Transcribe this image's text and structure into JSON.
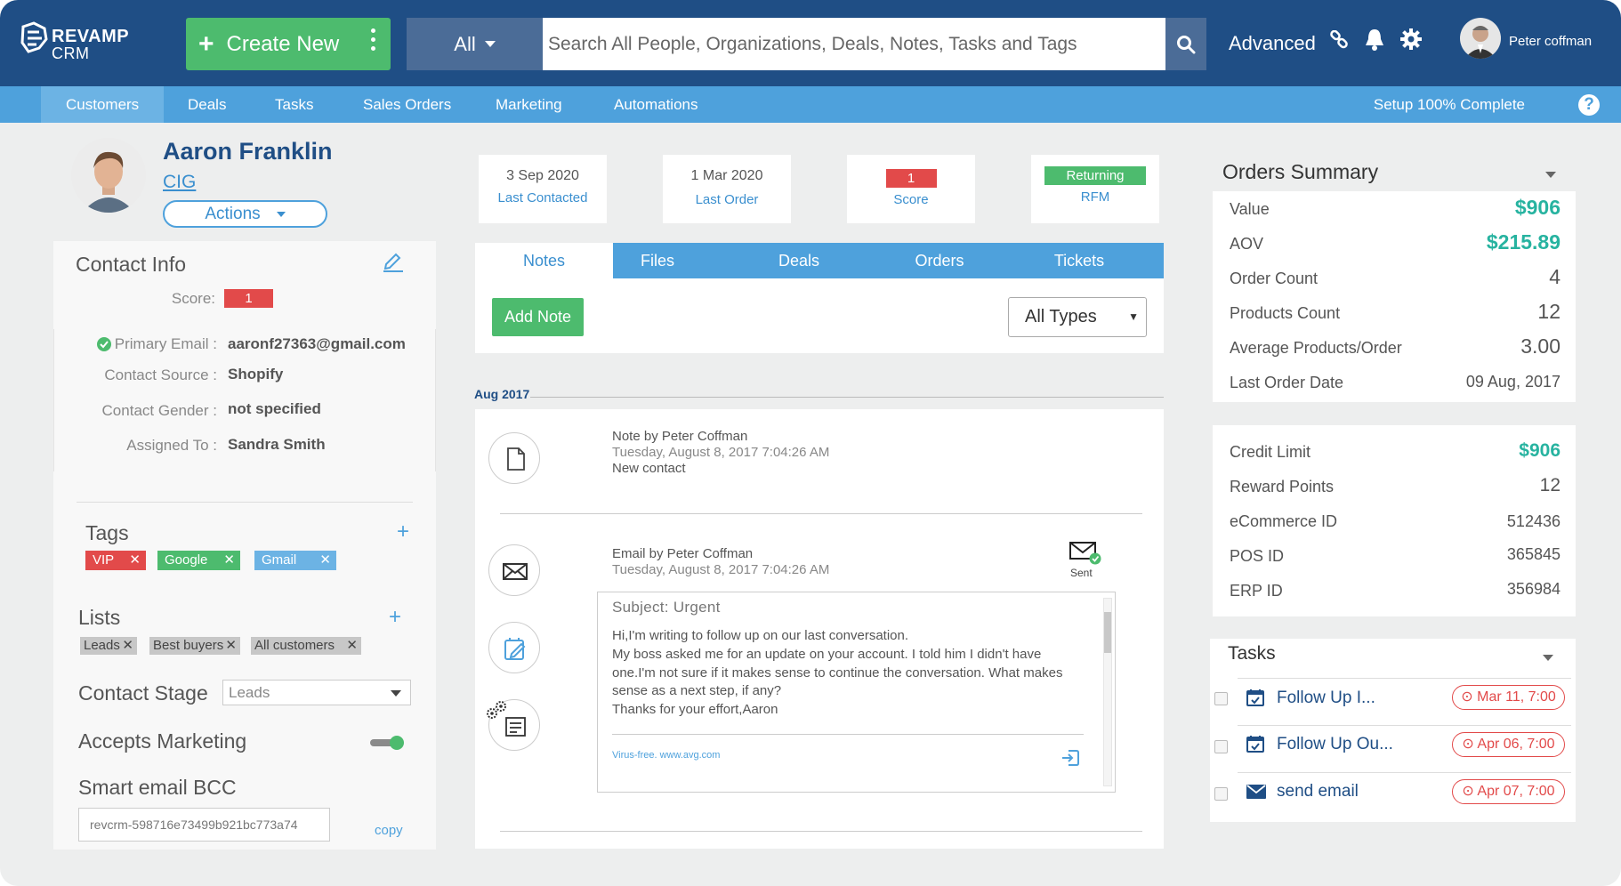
{
  "app": {
    "logo_line1": "REVAMP",
    "logo_line2": "CRM"
  },
  "header": {
    "create_label": "Create New",
    "scope_label": "All",
    "search_placeholder": "Search All People, Organizations, Deals, Notes, Tasks and Tags",
    "advanced_label": "Advanced",
    "user_name": "Peter coffman"
  },
  "nav": {
    "items": [
      "Customers",
      "Deals",
      "Tasks",
      "Sales Orders",
      "Marketing",
      "Automations"
    ],
    "setup_text": "Setup 100% Complete",
    "help_glyph": "?"
  },
  "contact": {
    "name": "Aaron Franklin",
    "company": "CIG",
    "actions_label": "Actions",
    "info_title": "Contact Info",
    "score_label": "Score:",
    "score_value": "1",
    "fields": [
      {
        "label": "Primary Email :",
        "value": "aaronf27363@gmail.com"
      },
      {
        "label": "Contact Source :",
        "value": "Shopify"
      },
      {
        "label": "Contact Gender :",
        "value": "not specified"
      },
      {
        "label": "Assigned To :",
        "value": "Sandra Smith"
      }
    ],
    "tags_title": "Tags",
    "tags": [
      {
        "label": "VIP",
        "color": "#e24a4a"
      },
      {
        "label": "Google",
        "color": "#4dbb6e"
      },
      {
        "label": "Gmail",
        "color": "#6cb3e4"
      }
    ],
    "lists_title": "Lists",
    "lists": [
      "Leads",
      "Best buyers",
      "All customers"
    ],
    "stage_title": "Contact Stage",
    "stage_value": "Leads",
    "marketing_title": "Accepts Marketing",
    "bcc_title": "Smart email BCC",
    "bcc_value": "revcrm-598716e73499b921bc773a74",
    "copy_label": "copy"
  },
  "stats": [
    {
      "value": "3 Sep 2020",
      "label": "Last Contacted"
    },
    {
      "value": "1 Mar 2020",
      "label": "Last Order"
    },
    {
      "value": "1",
      "label": "Score",
      "color": "#e24a4a"
    },
    {
      "value": "Returning",
      "label": "RFM",
      "color": "#4dbb6e"
    }
  ],
  "tabs": [
    "Notes",
    "Files",
    "Deals",
    "Orders",
    "Tickets"
  ],
  "notes": {
    "add_label": "Add Note",
    "filter_value": "All Types",
    "month": "Aug 2017",
    "entries": [
      {
        "title": "Note by Peter Coffman",
        "date": "Tuesday, August 8, 2017 7:04:26 AM",
        "text": "New contact"
      },
      {
        "title": "Email by Peter Coffman",
        "date": "Tuesday, August 8, 2017 7:04:26 AM"
      }
    ],
    "sent_label": "Sent",
    "email_subject": "Subject: Urgent",
    "email_body": [
      "Hi,I'm writing to follow up on our last conversation.",
      "My boss asked me for an update on your account. I told him I didn't have",
      "one.I'm not sure if it makes sense to continue the conversation. What makes",
      "sense as a next step, if any?",
      "Thanks for your effort,Aaron"
    ],
    "email_signature": "Virus-free. www.avg.com"
  },
  "orders_summary": {
    "title": "Orders Summary",
    "rows": [
      {
        "label": "Value",
        "value": "$906"
      },
      {
        "label": "AOV",
        "value": "$215.89"
      },
      {
        "label": "Order Count",
        "value": "4"
      },
      {
        "label": "Products Count",
        "value": "12"
      },
      {
        "label": "Average Products/Order",
        "value": "3.00"
      },
      {
        "label": "Last Order Date",
        "value": "09 Aug, 2017"
      }
    ]
  },
  "account": {
    "rows": [
      {
        "label": "Credit Limit",
        "value": "$906"
      },
      {
        "label": "Reward Points",
        "value": "12"
      },
      {
        "label": "eCommerce ID",
        "value": "512436"
      },
      {
        "label": "POS ID",
        "value": "365845"
      },
      {
        "label": "ERP ID",
        "value": "356984"
      }
    ]
  },
  "tasks": {
    "title": "Tasks",
    "items": [
      {
        "label": "Follow Up I...",
        "due": "Mar 11, 7:00",
        "icon": "calendar-check-icon"
      },
      {
        "label": "Follow Up Ou...",
        "due": "Apr 06, 7:00",
        "icon": "calendar-check-icon"
      },
      {
        "label": "send email",
        "due": "Apr 07, 7:00",
        "icon": "envelope-icon"
      }
    ]
  }
}
